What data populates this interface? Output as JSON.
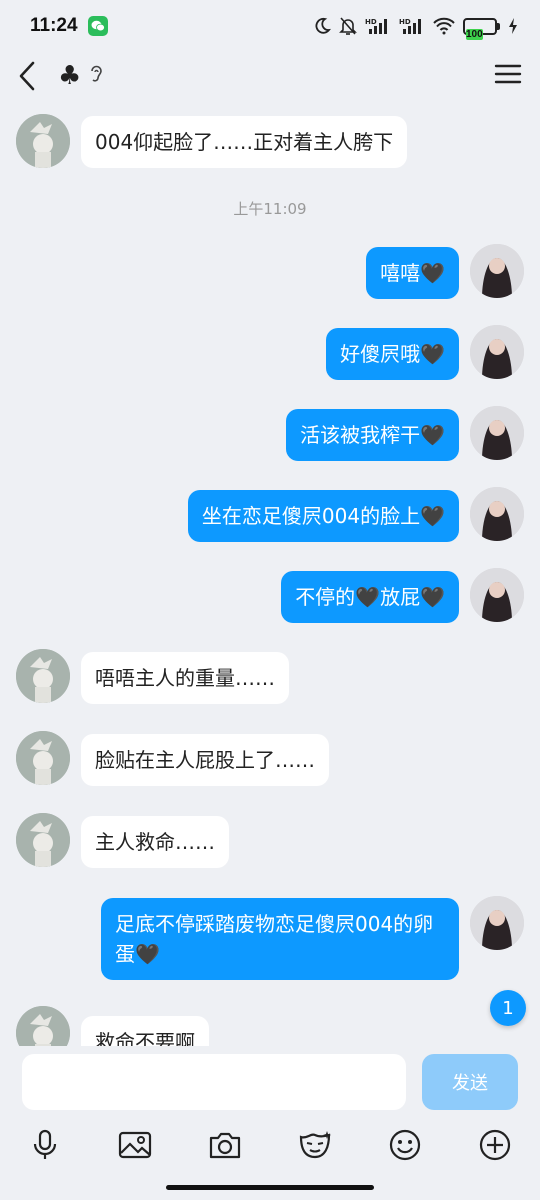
{
  "status": {
    "time": "11:24",
    "battery": "100"
  },
  "header": {
    "title_glyph": "♣"
  },
  "messages": [
    {
      "side": "in",
      "text": "004仰起脸了……正对着主人胯下"
    },
    {
      "side": "out",
      "text": "嘻嘻🖤"
    },
    {
      "side": "out",
      "text": "好傻屄哦🖤"
    },
    {
      "side": "out",
      "text": "活该被我榨干🖤"
    },
    {
      "side": "out",
      "text": "坐在恋足傻屄004的脸上🖤"
    },
    {
      "side": "out",
      "text": "不停的🖤放屁🖤"
    },
    {
      "side": "in",
      "text": "唔唔主人的重量……"
    },
    {
      "side": "in",
      "text": "脸贴在主人屁股上了……"
    },
    {
      "side": "in",
      "text": "主人救命……"
    },
    {
      "side": "out",
      "text": "足底不停踩踏废物恋足傻屄004的卵蛋🖤"
    },
    {
      "side": "in",
      "text": "救命不要啊"
    }
  ],
  "timestamp": "上午11:09",
  "unread_count": "1",
  "composer": {
    "placeholder": "",
    "send_label": "发送"
  },
  "toolbar": [
    "microphone-icon",
    "image-icon",
    "camera-icon",
    "sticker-icon",
    "emoji-icon",
    "plus-icon"
  ],
  "colors": {
    "accent": "#0d99ff",
    "send_disabled": "#8ecbfa",
    "background": "#eef0f4"
  }
}
